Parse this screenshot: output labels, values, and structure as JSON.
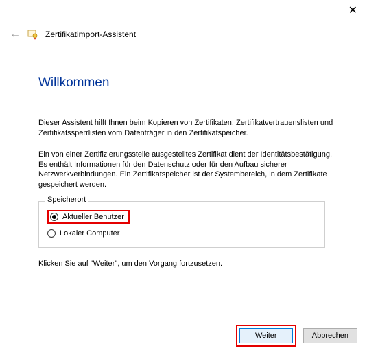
{
  "window": {
    "close_glyph": "✕"
  },
  "header": {
    "back_glyph": "←",
    "title": "Zertifikatimport-Assistent"
  },
  "content": {
    "heading": "Willkommen",
    "paragraph1": "Dieser Assistent hilft Ihnen beim Kopieren von Zertifikaten, Zertifikatvertrauenslisten und Zertifikatssperrlisten vom Datenträger in den Zertifikatspeicher.",
    "paragraph2": "Ein von einer Zertifizierungsstelle ausgestelltes Zertifikat dient der Identitätsbestätigung. Es enthält Informationen für den Datenschutz oder für den Aufbau sicherer Netzwerkverbindungen. Ein Zertifikatspeicher ist der Systembereich, in dem Zertifikate gespeichert werden.",
    "group_label": "Speicherort",
    "radio_current_user": "Aktueller Benutzer",
    "radio_local_computer": "Lokaler Computer",
    "continue_hint": "Klicken Sie auf \"Weiter\", um den Vorgang fortzusetzen."
  },
  "footer": {
    "next_label": "Weiter",
    "cancel_label": "Abbrechen"
  },
  "state": {
    "selected_radio": "current_user"
  },
  "colors": {
    "heading": "#003399",
    "highlight": "#e40000",
    "primary_border": "#0078d7"
  }
}
